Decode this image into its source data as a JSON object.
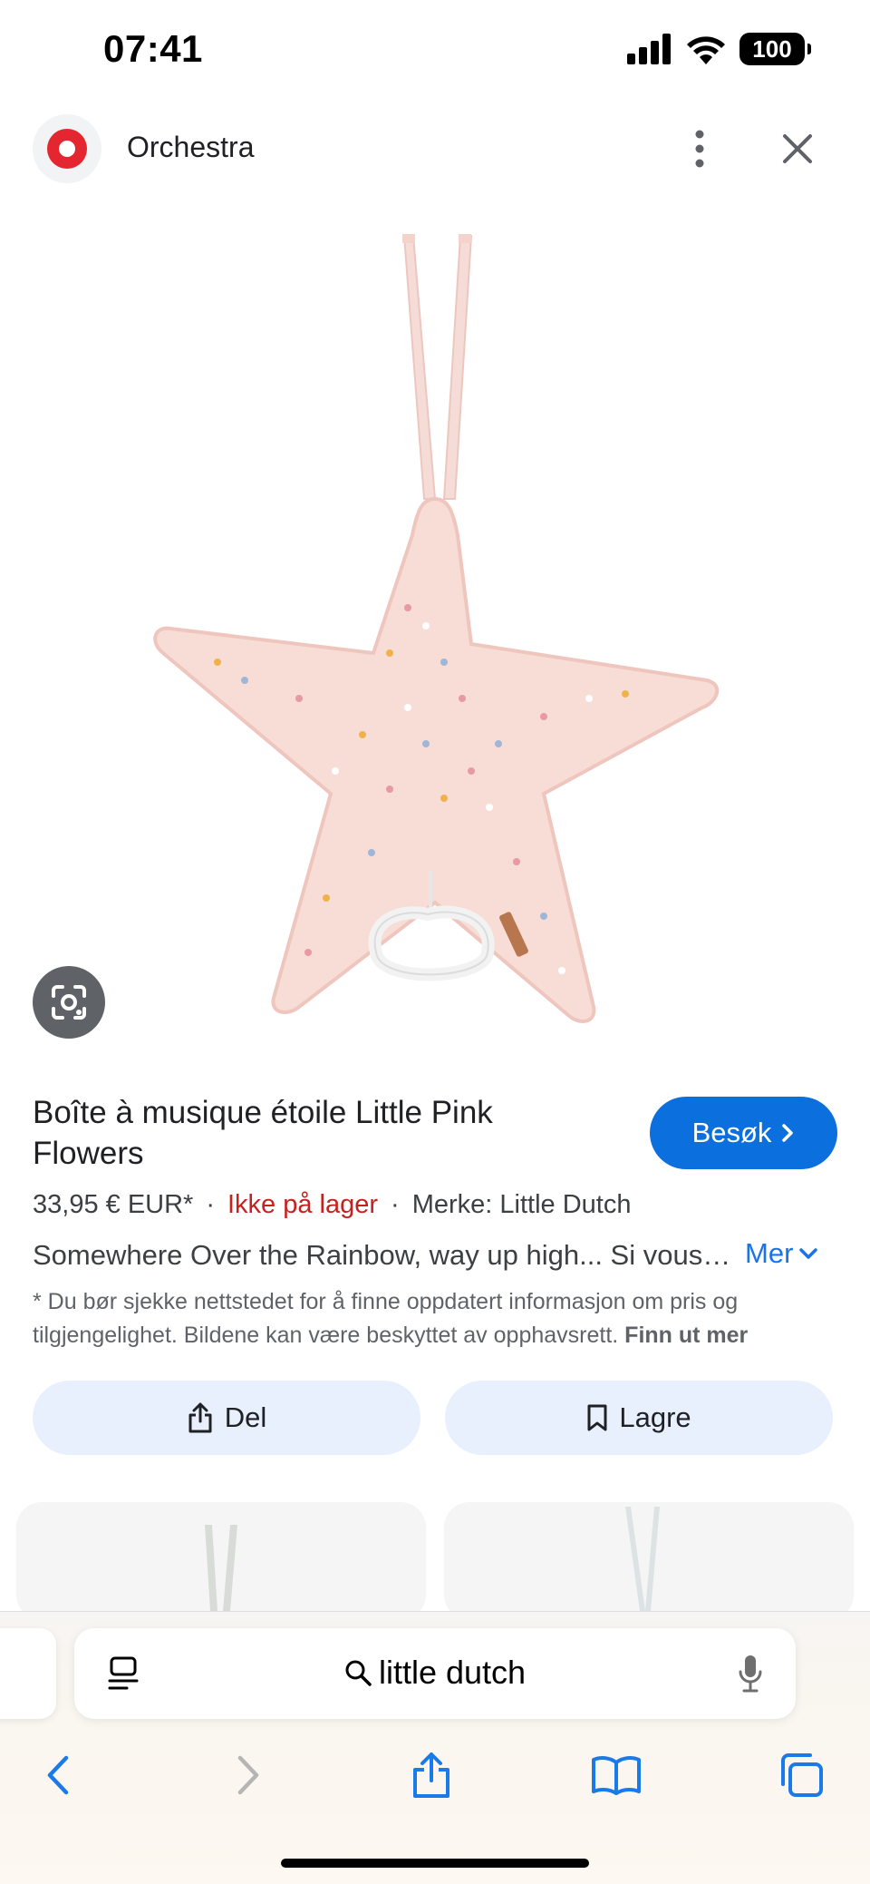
{
  "status_bar": {
    "time": "07:41",
    "battery": "100",
    "icons": [
      "signal-icon",
      "wifi-icon",
      "battery-icon"
    ]
  },
  "header": {
    "site_name": "Orchestra",
    "logo_color": "#e3262f"
  },
  "product": {
    "title": "Boîte à musique étoile Little Pink Flowers",
    "visit_label": "Besøk",
    "price": "33,95 € EUR*",
    "stock": "Ikke på lager",
    "brand": "Merke: Little Dutch",
    "description": "Somewhere Over the Rainbow, way up high... Si vous…",
    "more_label": "Mer",
    "disclaimer": "* Du bør sjekke nettstedet for å finne oppdatert informasjon om pris og tilgjengelighet. Bildene kan være beskyttet av opphavsrett.",
    "disclaimer_link": "Finn ut mer"
  },
  "actions": {
    "share_label": "Del",
    "save_label": "Lagre"
  },
  "browser": {
    "address": "little dutch"
  },
  "colors": {
    "accent": "#0b6fde",
    "link": "#1a73e8",
    "out_of_stock": "#c5221f",
    "action_bg": "#e8f0fe"
  }
}
